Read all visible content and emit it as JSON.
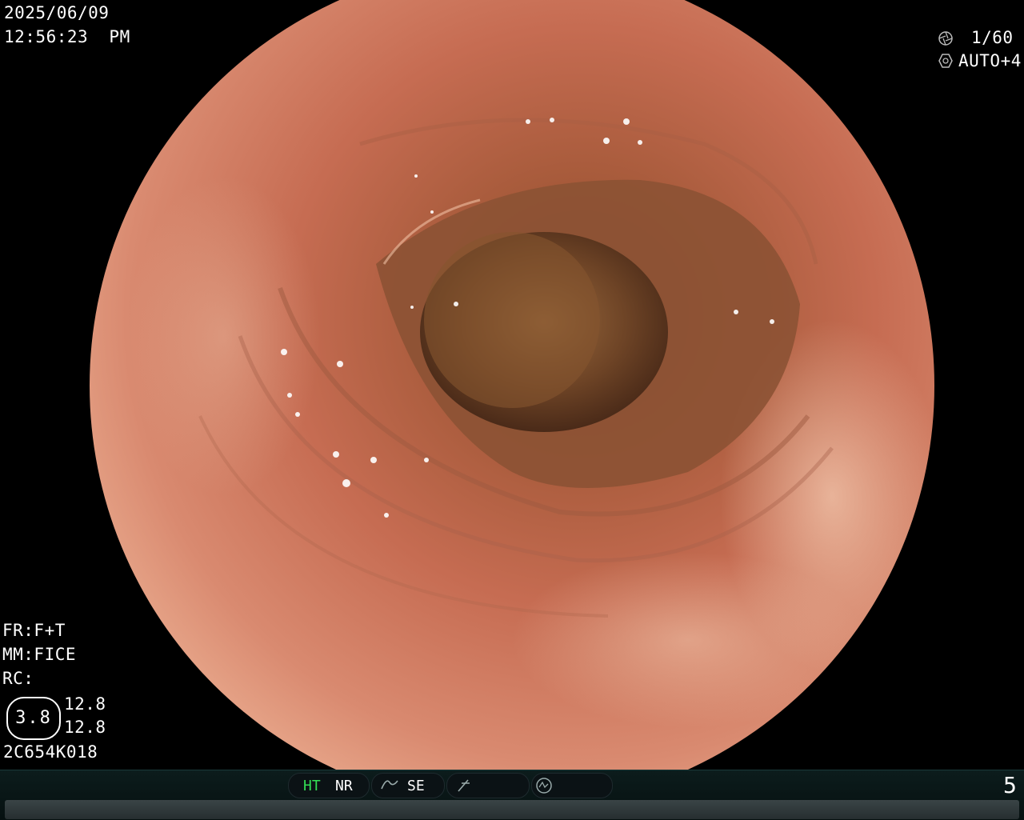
{
  "overlay": {
    "date": "2025/06/09",
    "time": "12:56:23  PM",
    "shutter": "1/60",
    "iris": "AUTO+4",
    "fr": "FR:F+T",
    "mm": "MM:FICE",
    "rc": "RC:",
    "fov_value": "3.8",
    "value_top": "12.8",
    "value_bottom": "12.8",
    "scope_id": "2C654K018"
  },
  "statusbar": {
    "ht": "HT",
    "nr": "NR",
    "se": "SE",
    "page_number": "5"
  },
  "icons": {
    "shutter": "shutter-icon",
    "iris": "iris-icon",
    "enhance": "enhance-curve-icon",
    "structure": "structure-icon",
    "mode": "mode-circle-icon"
  },
  "colors": {
    "mucosa": "#c8755c",
    "lumen": "#6a4226",
    "ht_active": "#33dd55",
    "background": "#000000"
  }
}
